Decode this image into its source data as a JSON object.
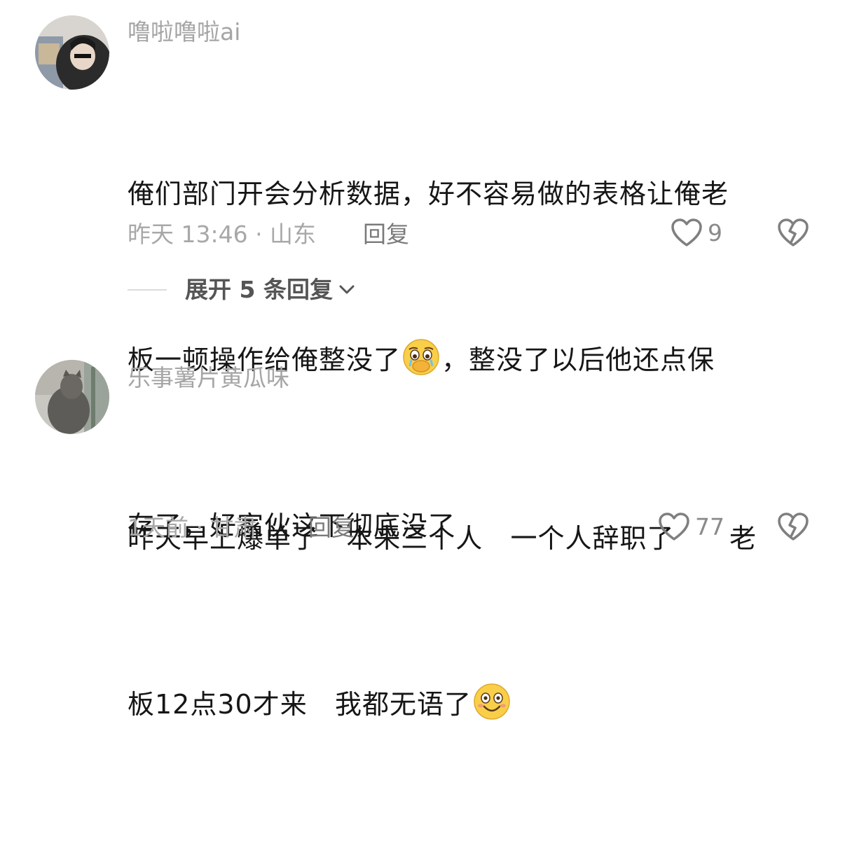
{
  "comments": [
    {
      "username": "噜啦噜啦ai",
      "text_line1": "俺们部门开会分析数据，好不容易做的表格让俺老",
      "text_line2a": "板一顿操作给俺整没了",
      "text_line2b": "，整没了以后他还点保",
      "text_line3": "存了，好家伙这下彻底没了",
      "emoji": "crying-face-emoji",
      "meta": "昨天 13:46 · 山东",
      "reply_label": "回复",
      "likes": "9",
      "expand_label": "展开 5 条回复"
    },
    {
      "username": "乐事薯片黄瓜味",
      "text_line1": "昨天早上爆单了   本来三个人   一个人辞职了      老",
      "text_line2": "板12点30才来   我都无语了",
      "emoji": "smiling-face-emoji",
      "meta": "1天前 · 甘肃",
      "reply_label": "回复",
      "likes": "77"
    }
  ],
  "colors": {
    "text": "#161616",
    "secondary": "#a5a5a5",
    "icon": "#8a8a8a",
    "background": "#ffffff"
  }
}
